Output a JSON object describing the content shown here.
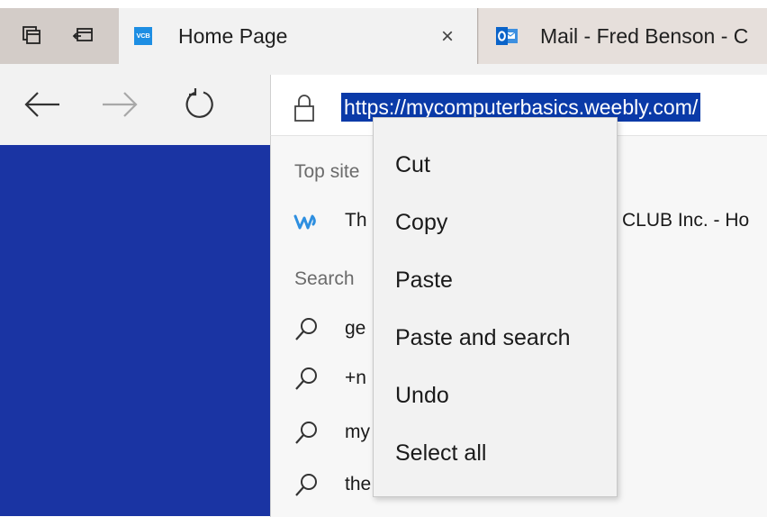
{
  "tabs": {
    "active": {
      "title": "Home Page",
      "favicon_text": "VCB",
      "close_glyph": "×"
    },
    "inactive": {
      "title": "Mail - Fred Benson - C"
    }
  },
  "address_bar": {
    "url": "https://mycomputerbasics.weebly.com/"
  },
  "dropdown": {
    "top_sites_heading": "Top site",
    "top_site_row": {
      "text_left": "Th",
      "text_right": "CLUB Inc. - Ho"
    },
    "search_heading": "Search",
    "search_rows": [
      {
        "text": "ge"
      },
      {
        "text": "+n"
      },
      {
        "text": "my"
      },
      {
        "text": "the"
      }
    ]
  },
  "context_menu": {
    "items": [
      "Cut",
      "Copy",
      "Paste",
      "Paste and search",
      "Undo",
      "Select all"
    ]
  },
  "colors": {
    "page_blue": "#1a34a3",
    "url_selection": "#0a3aa8",
    "vcb_favicon": "#1d8ee3",
    "weebly_icon": "#2e8fe0"
  }
}
